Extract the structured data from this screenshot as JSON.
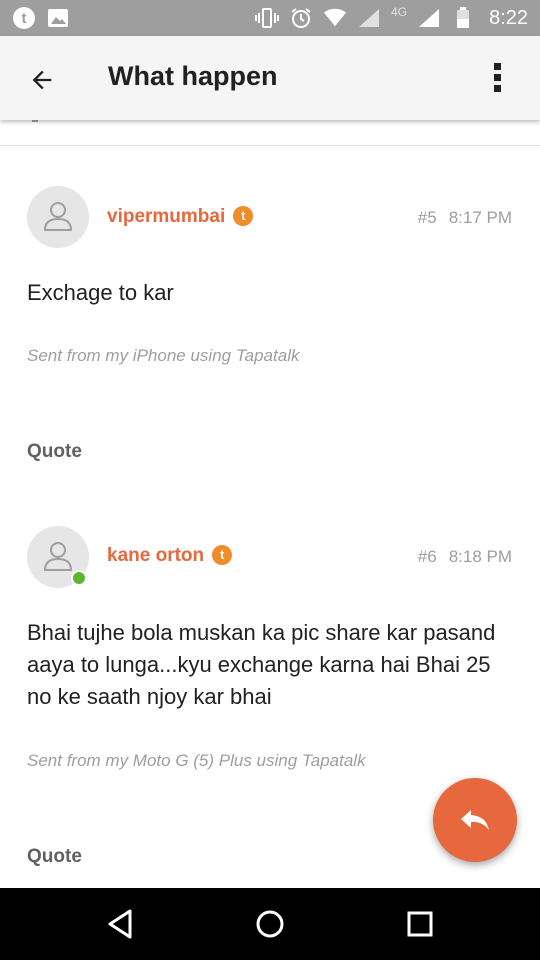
{
  "status_bar": {
    "time": "8:22",
    "network_label": "4G",
    "icons": [
      "tapatalk-notification-icon",
      "image-notification-icon",
      "vibrate-icon",
      "alarm-icon",
      "wifi-icon",
      "signal-icon",
      "battery-icon"
    ]
  },
  "app_bar": {
    "title": "What happen",
    "icons": [
      "back-arrow-icon",
      "more-vert-icon"
    ]
  },
  "posts": [
    {
      "username": "vipermumbai",
      "badge": "t",
      "number": "#5",
      "time": "8:17 PM",
      "body": "Exchage to kar",
      "signature": "Sent from my iPhone using Tapatalk",
      "quote_label": "Quote",
      "online": false
    },
    {
      "username": "kane orton",
      "badge": "t",
      "number": "#6",
      "time": "8:18 PM",
      "body": "Bhai tujhe bola muskan ka pic share kar pasand aaya to lunga...kyu exchange karna hai Bhai 25 no ke saath njoy kar bhai",
      "signature": "Sent from my Moto G (5) Plus using Tapatalk",
      "quote_label": "Quote",
      "online": true
    }
  ],
  "fab": {
    "icon": "reply-icon"
  },
  "nav_bar": {
    "icons": [
      "nav-back-icon",
      "nav-home-icon",
      "nav-recents-icon"
    ]
  },
  "colors": {
    "accent": "#e6683c",
    "badge": "#f08c2a",
    "online": "#5cb531",
    "status_bar": "#9e9e9e"
  }
}
